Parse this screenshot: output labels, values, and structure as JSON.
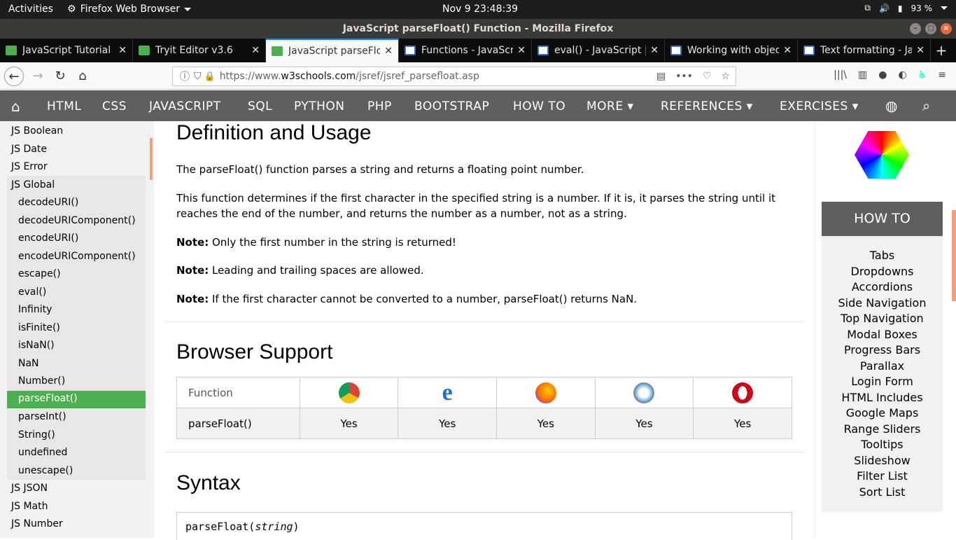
{
  "os": {
    "activities": "Activities",
    "app_name": "Firefox Web Browser",
    "clock": "Nov 9  23:48:39",
    "battery": "93 %"
  },
  "window": {
    "title": "JavaScript parseFloat() Function - Mozilla Firefox"
  },
  "tabs": [
    {
      "label": "JavaScript Tutorial",
      "icon": "w3"
    },
    {
      "label": "Tryit Editor v3.6",
      "icon": "w3"
    },
    {
      "label": "JavaScript parseFlo",
      "icon": "w3"
    },
    {
      "label": "Functions - JavaScr",
      "icon": "mdn"
    },
    {
      "label": "eval() - JavaScript |",
      "icon": "mdn"
    },
    {
      "label": "Working with objec",
      "icon": "mdn"
    },
    {
      "label": "Text formatting - Ja",
      "icon": "mdn"
    }
  ],
  "url": {
    "prefix": "https://www.",
    "domain": "w3schools.com",
    "path": "/jsref/jsref_parsefloat.asp"
  },
  "w3nav": {
    "items": [
      "HTML",
      "CSS",
      "JAVASCRIPT",
      "SQL",
      "PYTHON",
      "PHP",
      "BOOTSTRAP",
      "HOW TO",
      "MORE",
      "REFERENCES",
      "EXERCISES"
    ]
  },
  "sidebar": {
    "top": [
      "JS Boolean",
      "JS Date",
      "JS Error",
      "JS Global"
    ],
    "global": [
      "decodeURI()",
      "decodeURIComponent()",
      "encodeURI()",
      "encodeURIComponent()",
      "escape()",
      "eval()",
      "Infinity",
      "isFinite()",
      "isNaN()",
      "NaN",
      "Number()",
      "parseFloat()",
      "parseInt()",
      "String()",
      "undefined",
      "unescape()"
    ],
    "bottom": [
      "JS JSON",
      "JS Math",
      "JS Number"
    ]
  },
  "main": {
    "def_heading": "Definition and Usage",
    "p1": "The parseFloat() function parses a string and returns a floating point number.",
    "p2": "This function determines if the first character in the specified string is a number. If it is, it parses the string until it reaches the end of the number, and returns the number as a number, not as a string.",
    "note_label": "Note:",
    "note1": "Only the first number in the string is returned!",
    "note2": "Leading and trailing spaces are allowed.",
    "note3": "If the first character cannot be converted to a number, parseFloat() returns NaN.",
    "support_heading": "Browser Support",
    "table_header": "Function",
    "table_fn": "parseFloat()",
    "yes": "Yes",
    "syntax_heading": "Syntax",
    "syntax_fn": "parseFloat(",
    "syntax_arg": "string",
    "syntax_close": ")"
  },
  "howto": {
    "heading": "HOW TO",
    "links": [
      "Tabs",
      "Dropdowns",
      "Accordions",
      "Side Navigation",
      "Top Navigation",
      "Modal Boxes",
      "Progress Bars",
      "Parallax",
      "Login Form",
      "HTML Includes",
      "Google Maps",
      "Range Sliders",
      "Tooltips",
      "Slideshow",
      "Filter List",
      "Sort List"
    ]
  }
}
